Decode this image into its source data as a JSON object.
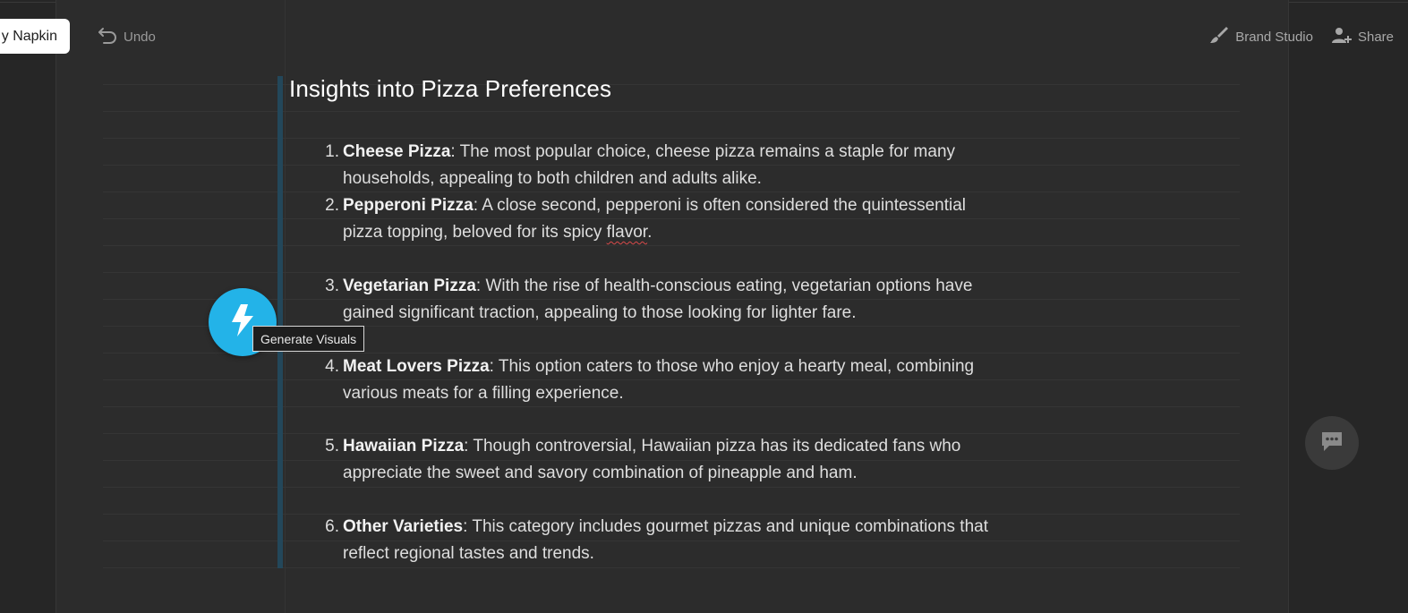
{
  "toolbar": {
    "napkin_label": "y Napkin",
    "undo_label": "Undo",
    "brand_studio_label": "Brand Studio",
    "share_label": "Share"
  },
  "document": {
    "title": "Insights into Pizza Preferences",
    "items": [
      {
        "number": "1.",
        "term": "Cheese Pizza",
        "line1": ": The most popular choice, cheese pizza remains a staple for many",
        "line2": "households, appealing to both children and adults alike."
      },
      {
        "number": "2.",
        "term": "Pepperoni Pizza",
        "line1": ": A close second, pepperoni is often considered the quintessential",
        "line2_pre": "pizza topping, beloved for its spicy ",
        "line2_flagged": "flavor",
        "line2_post": "."
      },
      {
        "number": "3.",
        "term": "Vegetarian Pizza",
        "line1": ": With the rise of health-conscious eating, vegetarian options have",
        "line2": "gained significant traction, appealing to those looking for lighter fare."
      },
      {
        "number": "4.",
        "term": "Meat Lovers Pizza",
        "line1": ": This option caters to those who enjoy a hearty meal, combining",
        "line2": "various meats for a filling experience."
      },
      {
        "number": "5.",
        "term": "Hawaiian Pizza",
        "line1": ": Though controversial, Hawaiian pizza has its dedicated fans who",
        "line2": "appreciate the sweet and savory combination of pineapple and ham."
      },
      {
        "number": "6.",
        "term": "Other Varieties",
        "line1": ": This category includes gourmet pizzas and unique combinations that",
        "line2": "reflect regional tastes and trends."
      }
    ]
  },
  "generate_visuals": {
    "tooltip": "Generate Visuals",
    "icon": "lightning-bolt-icon"
  },
  "chat": {
    "icon": "chat-bubble-icon"
  },
  "colors": {
    "background": "#262626",
    "page": "#2c2c2c",
    "accent_bar": "#23475a",
    "generate_button": "#23b3e8",
    "text": "#dedede"
  }
}
